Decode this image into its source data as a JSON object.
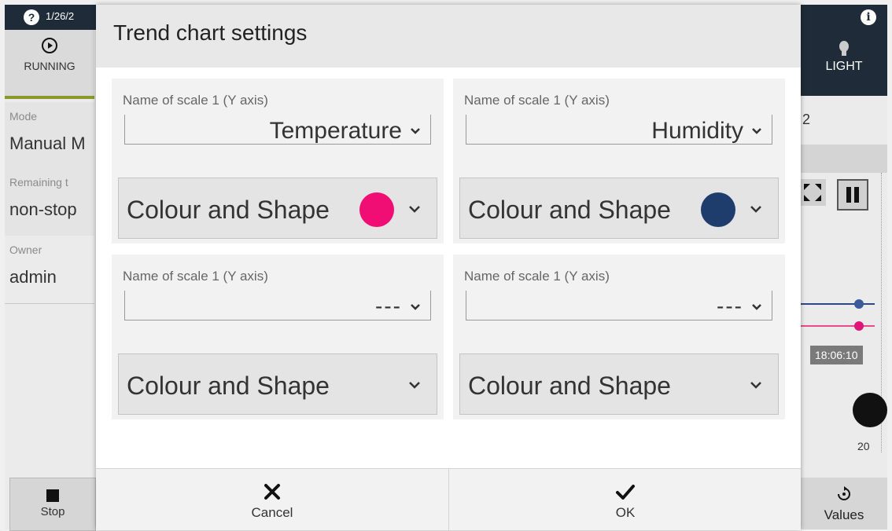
{
  "topbar": {
    "date": "1/26/2",
    "help_icon": "?",
    "info_icon": "i"
  },
  "left": {
    "running_label": "RUNNING",
    "fields": [
      {
        "key": "Mode",
        "value": "Manual M"
      },
      {
        "key": "Remaining t",
        "value": "non-stop"
      },
      {
        "key": "Owner",
        "value": "admin"
      }
    ],
    "stop_label": "Stop"
  },
  "right": {
    "light_label": "LIGHT",
    "chart_number": "2",
    "time_label": "18:06:10",
    "axis_number": "20",
    "values_label": "Values"
  },
  "dialog": {
    "title": "Trend chart settings",
    "cards": [
      {
        "label": "Name of scale 1 (Y axis)",
        "select_value": "Temperature",
        "colour_label": "Colour and Shape",
        "swatch": "#f00d74"
      },
      {
        "label": "Name of scale 1 (Y axis)",
        "select_value": "Humidity",
        "colour_label": "Colour and Shape",
        "swatch": "#1f3d6c"
      },
      {
        "label": "Name of scale 1 (Y axis)",
        "select_value": "---",
        "colour_label": "Colour and Shape",
        "swatch": ""
      },
      {
        "label": "Name of scale 1 (Y axis)",
        "select_value": "---",
        "colour_label": "Colour and Shape",
        "swatch": ""
      }
    ],
    "cancel_label": "Cancel",
    "ok_label": "OK"
  },
  "colors": {
    "dark_bar": "#1f2b38",
    "accent_olive": "#8a9a2a",
    "pink": "#f00d74",
    "navy": "#1f3d6c"
  },
  "icons": [
    "help-icon",
    "info-icon",
    "running-icon",
    "stop-icon",
    "bulb-icon",
    "expand-icon",
    "pause-icon",
    "values-icon",
    "chevron-down-icon",
    "close-icon",
    "check-icon"
  ]
}
